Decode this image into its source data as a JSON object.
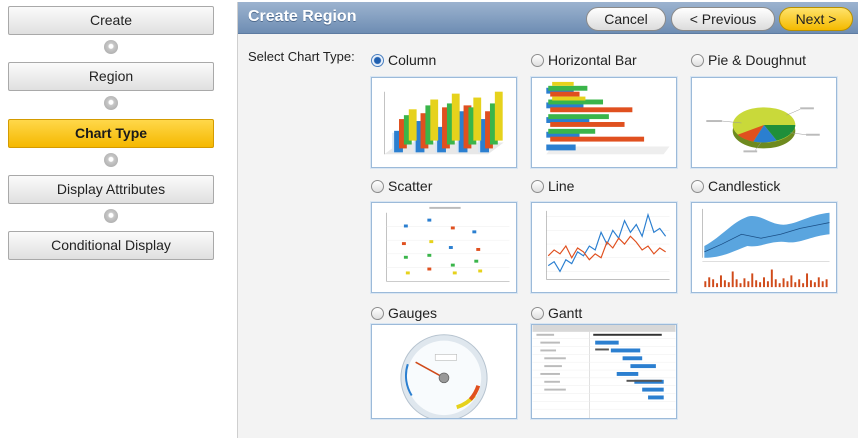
{
  "wizard": {
    "steps": [
      {
        "label": "Create"
      },
      {
        "label": "Region"
      },
      {
        "label": "Chart Type"
      },
      {
        "label": "Display Attributes"
      },
      {
        "label": "Conditional Display"
      }
    ],
    "active_step": "Chart Type"
  },
  "panel": {
    "title": "Create Region",
    "cancel_label": "Cancel",
    "previous_label": "< Previous",
    "next_label": "Next >",
    "select_label": "Select Chart Type:"
  },
  "chart_types": [
    {
      "label": "Column",
      "selected": true,
      "icon": "column-chart-thumbnail"
    },
    {
      "label": "Horizontal Bar",
      "selected": false,
      "icon": "horizontal-bar-chart-thumbnail"
    },
    {
      "label": "Pie & Doughnut",
      "selected": false,
      "icon": "pie-chart-thumbnail"
    },
    {
      "label": "Scatter",
      "selected": false,
      "icon": "scatter-chart-thumbnail"
    },
    {
      "label": "Line",
      "selected": false,
      "icon": "line-chart-thumbnail"
    },
    {
      "label": "Candlestick",
      "selected": false,
      "icon": "candlestick-chart-thumbnail"
    },
    {
      "label": "Gauges",
      "selected": false,
      "icon": "gauge-chart-thumbnail"
    },
    {
      "label": "Gantt",
      "selected": false,
      "icon": "gantt-chart-thumbnail"
    }
  ],
  "colors": {
    "accent": "#f5b800",
    "header": "#7b97bb",
    "thumb_border": "#9cbad9"
  }
}
